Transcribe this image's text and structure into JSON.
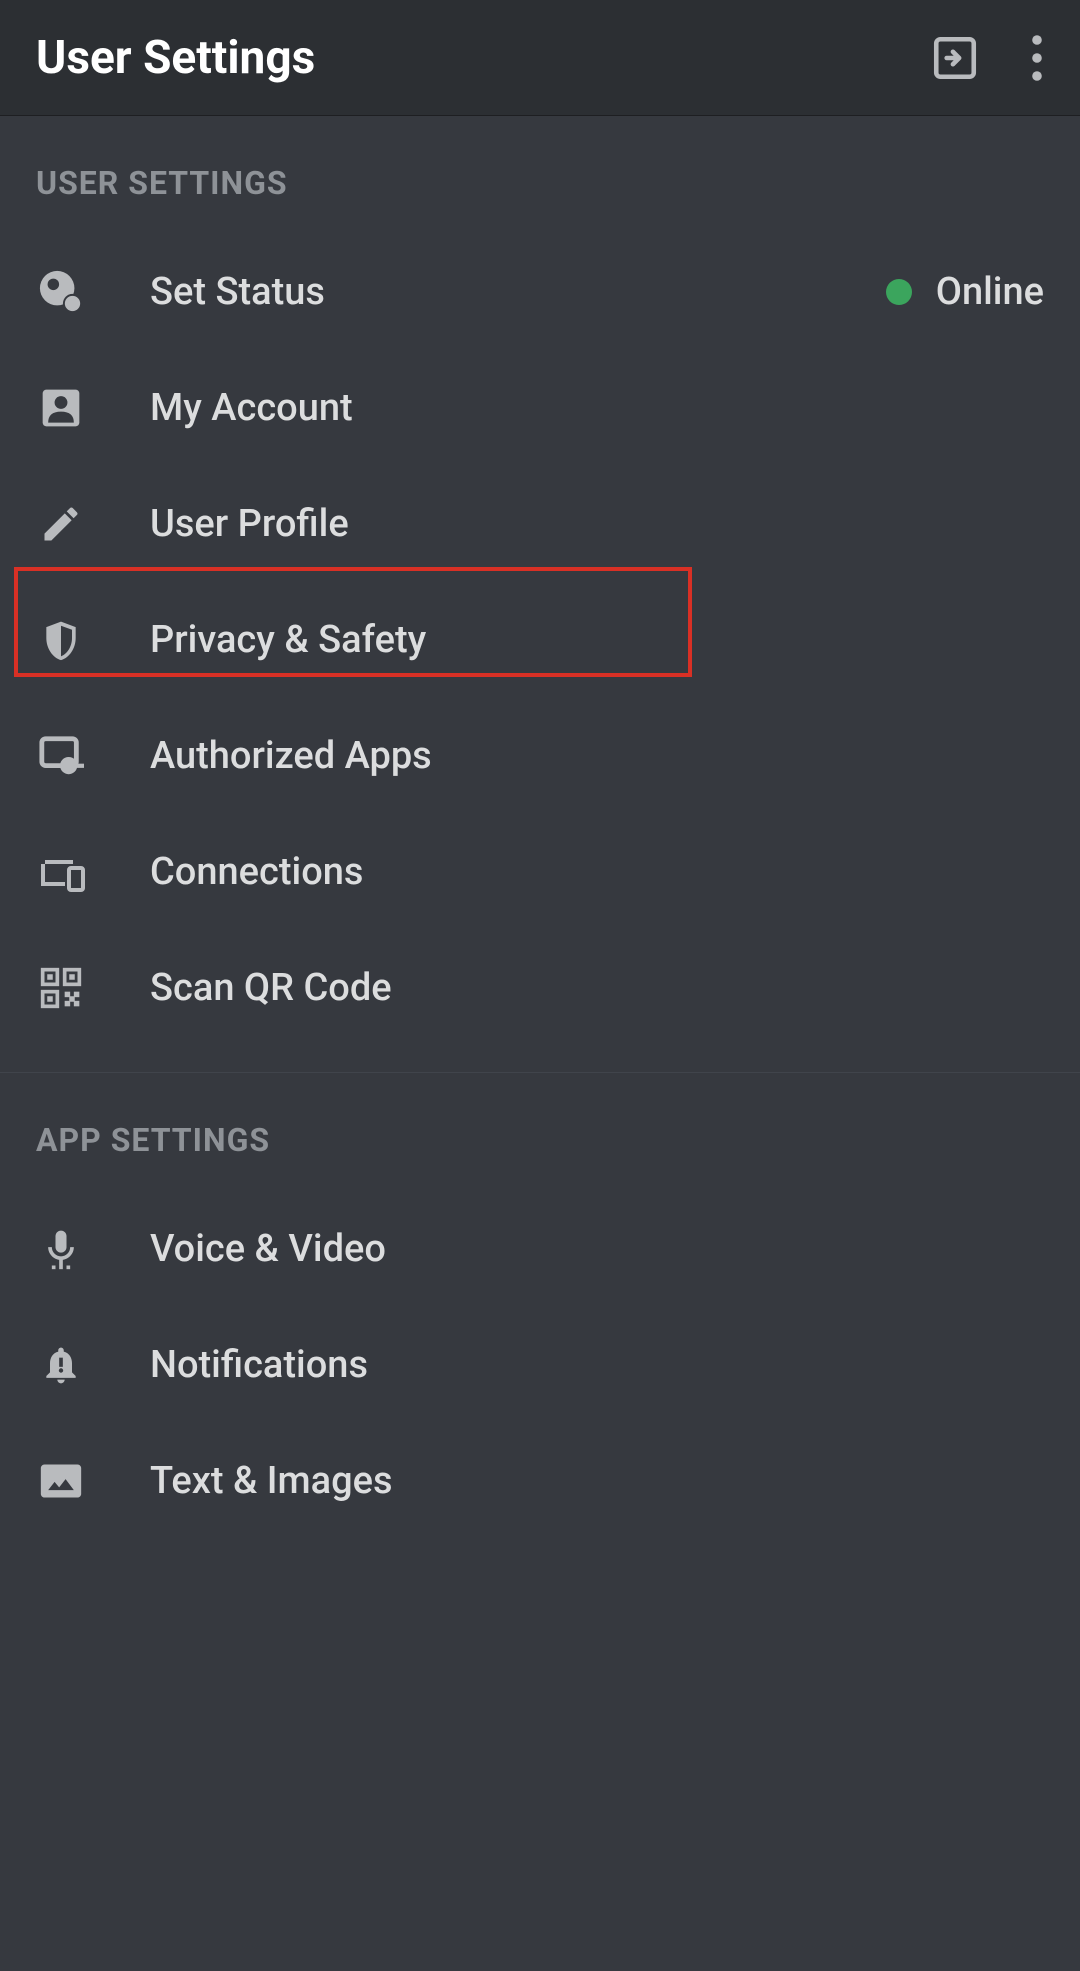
{
  "header": {
    "title": "User Settings"
  },
  "sections": {
    "user_settings_label": "USER SETTINGS",
    "app_settings_label": "APP SETTINGS"
  },
  "status": {
    "label": "Online"
  },
  "menu": {
    "set_status": "Set Status",
    "my_account": "My Account",
    "user_profile": "User Profile",
    "privacy_safety": "Privacy & Safety",
    "authorized_apps": "Authorized Apps",
    "connections": "Connections",
    "scan_qr": "Scan QR Code",
    "voice_video": "Voice & Video",
    "notifications": "Notifications",
    "text_images": "Text & Images"
  }
}
